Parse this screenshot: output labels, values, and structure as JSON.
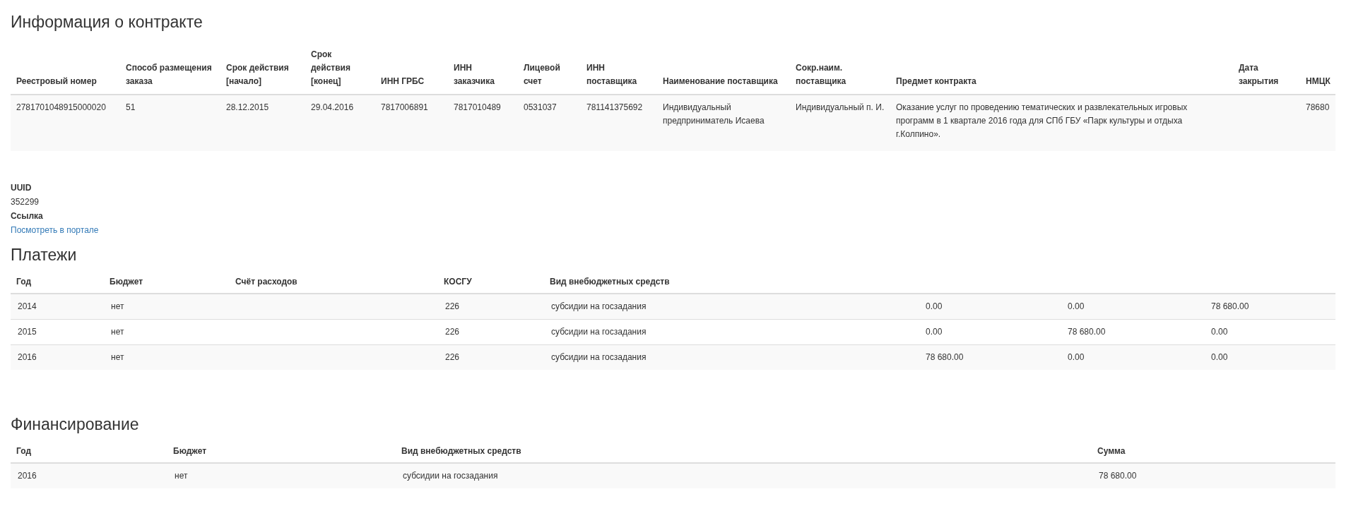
{
  "contract": {
    "title": "Информация о контракте",
    "columns": [
      "Реестровый номер",
      "Способ размещения заказа",
      "Срок действия [начало]",
      "Срок действия [конец]",
      "ИНН ГРБС",
      "ИНН заказчика",
      "Лицевой счет",
      "ИНН поставщика",
      "Наименование поставщика",
      "Сокр.наим. поставщика",
      "Предмет контракта",
      "Дата закрытия",
      "НМЦК"
    ],
    "rows": [
      [
        "2781701048915000020",
        "51",
        "28.12.2015",
        "29.04.2016",
        "7817006891",
        "7817010489",
        "0531037",
        "781141375692",
        "Индивидуальный предприниматель Исаева",
        "Индивидуальный п. И.",
        "Оказание услуг по проведению тематических и развлекательных игровых программ в 1 квартале 2016 года для СПб ГБУ «Парк культуры и отдыха г.Колпино».",
        "",
        "78680"
      ]
    ]
  },
  "details": [
    {
      "label": "UUID",
      "value": "352299",
      "kind": "text"
    },
    {
      "label": "Ссылка",
      "value": "Посмотреть в портале",
      "kind": "link"
    }
  ],
  "payments": {
    "title": "Платежи",
    "columns": [
      "Год",
      "Бюджет",
      "Счёт расходов",
      "КОСГУ",
      "Вид внебюджетных средств"
    ],
    "rows": [
      [
        "2014",
        "нет",
        "",
        "226",
        "субсидии на госзадания",
        "0.00",
        "0.00",
        "78 680.00"
      ],
      [
        "2015",
        "нет",
        "",
        "226",
        "субсидии на госзадания",
        "0.00",
        "78 680.00",
        "0.00"
      ],
      [
        "2016",
        "нет",
        "",
        "226",
        "субсидии на госзадания",
        "78 680.00",
        "0.00",
        "0.00"
      ]
    ]
  },
  "financing": {
    "title": "Финансирование",
    "columns": [
      "Год",
      "Бюджет",
      "Вид внебюджетных средств",
      "Сумма"
    ],
    "rows": [
      [
        "2016",
        "нет",
        "субсидии на госзадания",
        "78 680.00"
      ]
    ]
  }
}
